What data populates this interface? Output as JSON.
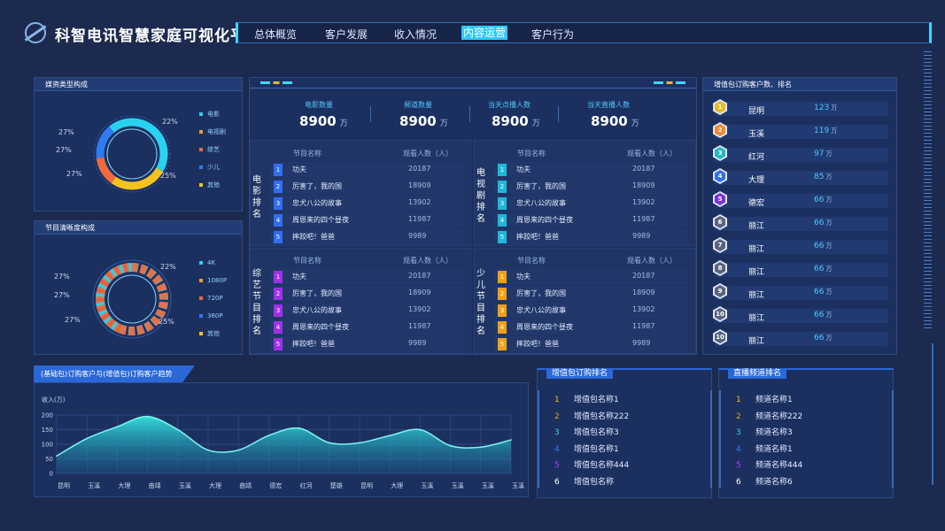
{
  "app": {
    "title": "科智电讯智慧家庭可视化平台"
  },
  "nav": {
    "items": [
      "总体概览",
      "客户发展",
      "收入情况",
      "内容运营",
      "客户行为"
    ],
    "active_index": 3
  },
  "media_type": {
    "title": "媒资类型构成",
    "percents": [
      "22%",
      "27%",
      "27%",
      "27%",
      "25%"
    ],
    "legend": [
      {
        "label": "电影",
        "color": "#29d3f0"
      },
      {
        "label": "电视剧",
        "color": "#f29a2e"
      },
      {
        "label": "综艺",
        "color": "#ef6a3c"
      },
      {
        "label": "少儿",
        "color": "#2f7bf2"
      },
      {
        "label": "其他",
        "color": "#f4c21e"
      }
    ]
  },
  "resolution": {
    "title": "节目清晰度构成",
    "percents": [
      "22%",
      "27%",
      "27%",
      "27%",
      "25%"
    ],
    "legend": [
      {
        "label": "4K",
        "color": "#29d3f0"
      },
      {
        "label": "1080P",
        "color": "#f29a2e"
      },
      {
        "label": "720P",
        "color": "#ef6a3c"
      },
      {
        "label": "360P",
        "color": "#2f7bf2"
      },
      {
        "label": "其他",
        "color": "#f4c21e"
      }
    ]
  },
  "kpis": [
    {
      "label": "电影数量",
      "value": "8900",
      "unit": "万"
    },
    {
      "label": "频道数量",
      "value": "8900",
      "unit": "万"
    },
    {
      "label": "当天点播人数",
      "value": "8900",
      "unit": "万"
    },
    {
      "label": "当天直播人数",
      "value": "8900",
      "unit": "万"
    }
  ],
  "rank_headers": {
    "name": "节目名称",
    "viewers": "观看人数（人）"
  },
  "rank_blocks": [
    {
      "label": "电影排名",
      "color": "#2f6ff0",
      "rows": [
        [
          "1",
          "功夫",
          "20187"
        ],
        [
          "2",
          "厉害了，我的国",
          "18909"
        ],
        [
          "3",
          "忠犬八公的故事",
          "13902"
        ],
        [
          "4",
          "周恩来的四个昼夜",
          "11987"
        ],
        [
          "5",
          "摔跤吧！爸爸",
          "9989"
        ]
      ]
    },
    {
      "label": "电视剧排名",
      "color": "#1fb8d8",
      "rows": [
        [
          "1",
          "功夫",
          "20187"
        ],
        [
          "2",
          "厉害了，我的国",
          "18909"
        ],
        [
          "3",
          "忠犬八公的故事",
          "13902"
        ],
        [
          "4",
          "周恩来的四个昼夜",
          "11987"
        ],
        [
          "5",
          "摔跤吧！爸爸",
          "9989"
        ]
      ]
    },
    {
      "label": "综艺节目排名",
      "color": "#a030e8",
      "rows": [
        [
          "1",
          "功夫",
          "20187"
        ],
        [
          "2",
          "厉害了，我的国",
          "18909"
        ],
        [
          "3",
          "忠犬八公的故事",
          "13902"
        ],
        [
          "4",
          "周恩来的四个昼夜",
          "11987"
        ],
        [
          "5",
          "摔跤吧！爸爸",
          "9989"
        ]
      ]
    },
    {
      "label": "少儿节目排名",
      "color": "#f0a018",
      "rows": [
        [
          "1",
          "功夫",
          "20187"
        ],
        [
          "2",
          "厉害了，我的国",
          "18909"
        ],
        [
          "3",
          "忠犬八公的故事",
          "13902"
        ],
        [
          "4",
          "周恩来的四个昼夜",
          "11987"
        ],
        [
          "5",
          "摔跤吧！爸爸",
          "9989"
        ]
      ]
    }
  ],
  "vip_rank": {
    "title": "增值包订购客户数、排名",
    "rows": [
      {
        "rank": "1",
        "name": "昆明",
        "value": "123",
        "unit": "万",
        "color": "#e8b92a"
      },
      {
        "rank": "2",
        "name": "玉溪",
        "value": "119",
        "unit": "万",
        "color": "#f08a2a"
      },
      {
        "rank": "3",
        "name": "红河",
        "value": "97",
        "unit": "万",
        "color": "#1fb8c8"
      },
      {
        "rank": "4",
        "name": "大理",
        "value": "85",
        "unit": "万",
        "color": "#2f6ff0"
      },
      {
        "rank": "5",
        "name": "德宏",
        "value": "66",
        "unit": "万",
        "color": "#7a30d8"
      },
      {
        "rank": "6",
        "name": "丽江",
        "value": "66",
        "unit": "万",
        "color": "#5a6480"
      },
      {
        "rank": "7",
        "name": "丽江",
        "value": "66",
        "unit": "万",
        "color": "#5a6480"
      },
      {
        "rank": "8",
        "name": "丽江",
        "value": "66",
        "unit": "万",
        "color": "#5a6480"
      },
      {
        "rank": "9",
        "name": "丽江",
        "value": "66",
        "unit": "万",
        "color": "#5a6480"
      },
      {
        "rank": "10",
        "name": "丽江",
        "value": "66",
        "unit": "万",
        "color": "#5a6480"
      },
      {
        "rank": "10",
        "name": "丽江",
        "value": "66",
        "unit": "万",
        "color": "#5a6480"
      }
    ]
  },
  "trend": {
    "title": "(基础包)订购客户与(增值包)订购客户趋势",
    "ylabel": "收入(万)"
  },
  "chart_data": {
    "type": "area",
    "title": "(基础包)订购客户与(增值包)订购客户趋势",
    "ylabel": "收入(万)",
    "categories": [
      "昆明",
      "玉溪",
      "大理",
      "曲靖",
      "玉溪",
      "大理",
      "曲靖",
      "德宏",
      "红河",
      "楚雄",
      "昆明",
      "大理",
      "玉溪",
      "玉溪",
      "玉溪",
      "玉溪"
    ],
    "values": [
      60,
      120,
      160,
      195,
      150,
      80,
      80,
      130,
      155,
      105,
      105,
      130,
      150,
      95,
      90,
      115
    ],
    "yticks": [
      0,
      50,
      100,
      150,
      200
    ],
    "ylim": [
      0,
      200
    ],
    "grid": true
  },
  "package_rank": {
    "title": "增值包订购排名",
    "rows": [
      [
        "1",
        "增值包名称1"
      ],
      [
        "2",
        "增值包名称222"
      ],
      [
        "3",
        "增值包名称3"
      ],
      [
        "4",
        "增值包名称1"
      ],
      [
        "5",
        "增值包名称444"
      ],
      [
        "6",
        "增值包名称"
      ]
    ]
  },
  "channel_rank": {
    "title": "直播频道排名",
    "rows": [
      [
        "1",
        "频道名称1"
      ],
      [
        "2",
        "频道名称222"
      ],
      [
        "3",
        "频道名称3"
      ],
      [
        "4",
        "频道名称1"
      ],
      [
        "5",
        "频道名称444"
      ],
      [
        "6",
        "频道名称6"
      ]
    ]
  },
  "list_colors": [
    "#f4c21e",
    "#f29a2e",
    "#29d3f0",
    "#2f7bf2",
    "#c040f0",
    "#ffffff"
  ]
}
